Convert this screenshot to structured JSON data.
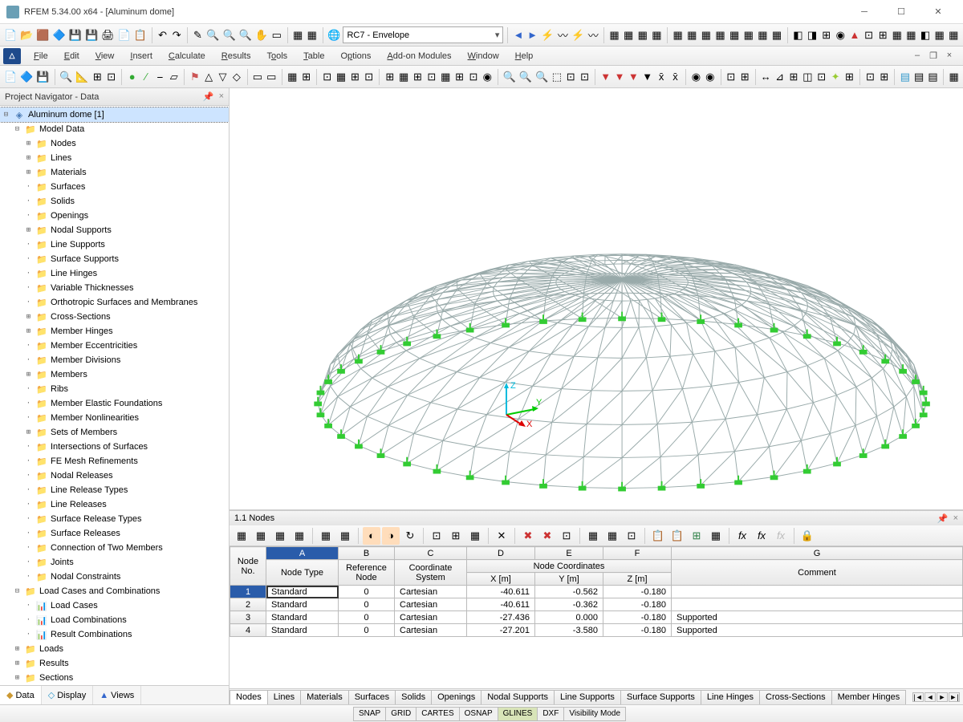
{
  "window": {
    "title": "RFEM 5.34.00 x64 - [Aluminum dome]"
  },
  "combo": {
    "value": "RC7 - Envelope"
  },
  "menu": {
    "items": [
      "File",
      "Edit",
      "View",
      "Insert",
      "Calculate",
      "Results",
      "Tools",
      "Table",
      "Options",
      "Add-on Modules",
      "Window",
      "Help"
    ]
  },
  "nav": {
    "title": "Project Navigator - Data",
    "project": "Aluminum dome [1]",
    "modelData": "Model Data",
    "items": [
      "Nodes",
      "Lines",
      "Materials",
      "Surfaces",
      "Solids",
      "Openings",
      "Nodal Supports",
      "Line Supports",
      "Surface Supports",
      "Line Hinges",
      "Variable Thicknesses",
      "Orthotropic Surfaces and Membranes",
      "Cross-Sections",
      "Member Hinges",
      "Member Eccentricities",
      "Member Divisions",
      "Members",
      "Ribs",
      "Member Elastic Foundations",
      "Member Nonlinearities",
      "Sets of Members",
      "Intersections of Surfaces",
      "FE Mesh Refinements",
      "Nodal Releases",
      "Line Release Types",
      "Line Releases",
      "Surface Release Types",
      "Surface Releases",
      "Connection of Two Members",
      "Joints",
      "Nodal Constraints"
    ],
    "lcc": "Load Cases and Combinations",
    "lccItems": [
      "Load Cases",
      "Load Combinations",
      "Result Combinations"
    ],
    "other": [
      "Loads",
      "Results",
      "Sections"
    ],
    "tabs": [
      "Data",
      "Display",
      "Views"
    ]
  },
  "table": {
    "title": "1.1 Nodes",
    "letters": [
      "A",
      "B",
      "C",
      "D",
      "E",
      "F",
      "G"
    ],
    "group": {
      "no": "Node No.",
      "nc": "Node Coordinates"
    },
    "headers": [
      "Node Type",
      "Reference Node",
      "Coordinate System",
      "X [m]",
      "Y [m]",
      "Z [m]",
      "Comment"
    ],
    "rows": [
      {
        "n": "1",
        "type": "Standard",
        "ref": "0",
        "cs": "Cartesian",
        "x": "-40.611",
        "y": "-0.562",
        "z": "-0.180",
        "c": ""
      },
      {
        "n": "2",
        "type": "Standard",
        "ref": "0",
        "cs": "Cartesian",
        "x": "-40.611",
        "y": "-0.362",
        "z": "-0.180",
        "c": ""
      },
      {
        "n": "3",
        "type": "Standard",
        "ref": "0",
        "cs": "Cartesian",
        "x": "-27.436",
        "y": "0.000",
        "z": "-0.180",
        "c": "Supported"
      },
      {
        "n": "4",
        "type": "Standard",
        "ref": "0",
        "cs": "Cartesian",
        "x": "-27.201",
        "y": "-3.580",
        "z": "-0.180",
        "c": "Supported"
      }
    ],
    "tabs": [
      "Nodes",
      "Lines",
      "Materials",
      "Surfaces",
      "Solids",
      "Openings",
      "Nodal Supports",
      "Line Supports",
      "Surface Supports",
      "Line Hinges",
      "Cross-Sections",
      "Member Hinges"
    ]
  },
  "status": {
    "items": [
      "SNAP",
      "GRID",
      "CARTES",
      "OSNAP",
      "GLINES",
      "DXF",
      "Visibility Mode"
    ]
  },
  "axes": {
    "x": "X",
    "y": "Y",
    "z": "Z"
  }
}
